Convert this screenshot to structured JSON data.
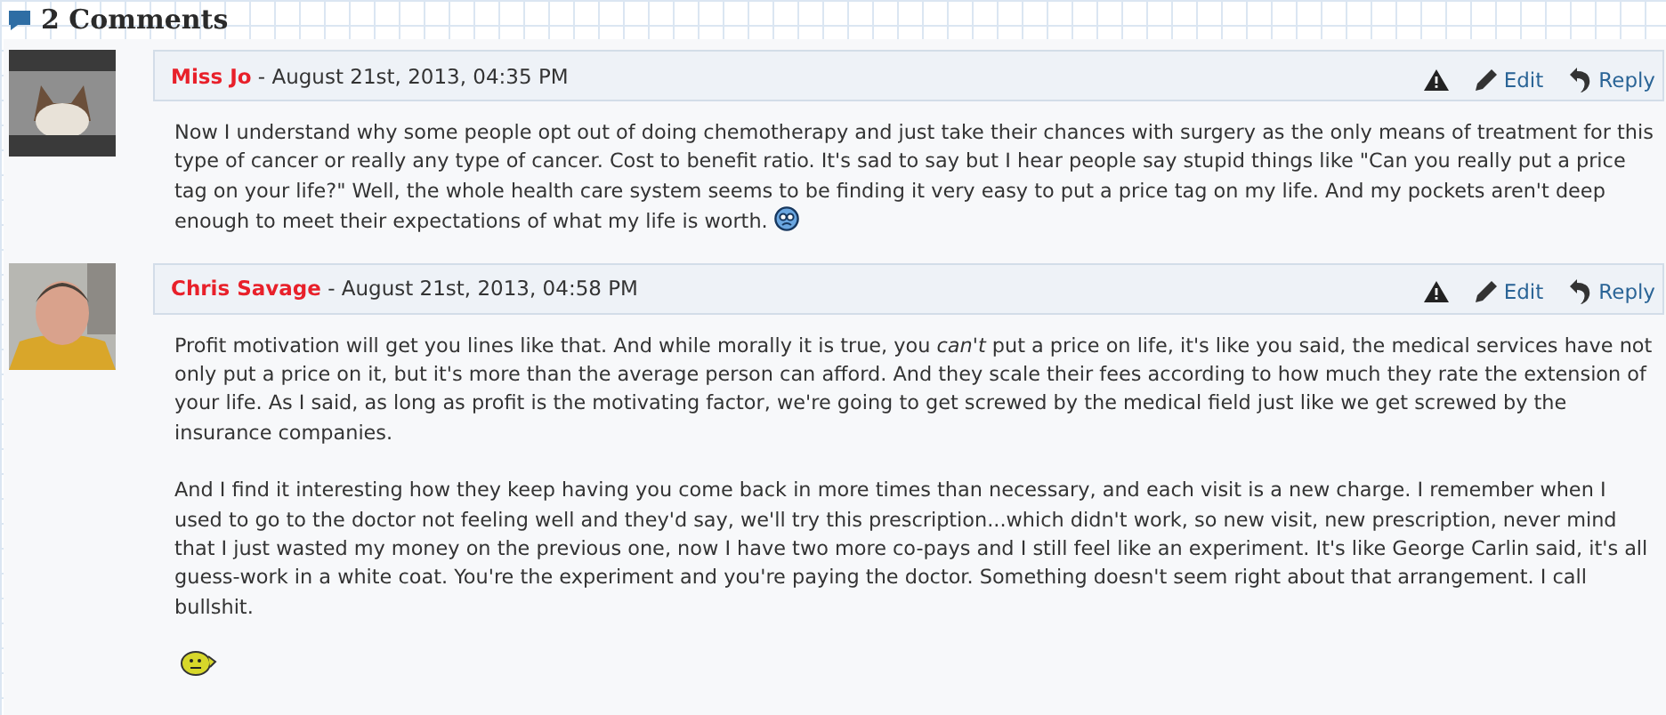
{
  "heading": {
    "count_label": "2 Comments"
  },
  "comments": [
    {
      "author": "Miss Jo",
      "date": " - August 21st, 2013, 04:35 PM",
      "avatar": {
        "kind": "picture"
      },
      "actions": [
        "Edit",
        "Reply"
      ],
      "trailing_emoticon": true,
      "paragraphs": [
        {
          "kind": "text",
          "text": "Now I understand why some people opt out of doing chemotherapy and just take their chances with surgery as the only means of treatment for this type of cancer or really any type of cancer. Cost to benefit ratio. It's sad to say but I hear people say stupid things like \"Can you really put a price tag on your life?\" Well, the whole health care system seems to be finding it very easy to put a price tag on my life. And my pockets aren't deep enough to meet their expectations of what my life is worth."
        }
      ]
    },
    {
      "author": "Chris Savage",
      "date": " - August 21st, 2013, 04:58 PM",
      "avatar": {
        "kind": "picture"
      },
      "actions": [
        "Edit",
        "Reply"
      ],
      "trailing_emoticon": false,
      "paragraphs": [
        {
          "kind": "text",
          "text": "Profit motivation will get you lines like that. And while morally it is true, you *can't* put a price on life, it's like you said, the medical services have not only put a price on it, but it's more than the average person can afford. And they scale their fees according to how much they rate the extension of your life. As I said, as long as profit is the motivating factor, we're going to get screwed by the medical field just like we get screwed by the insurance companies."
        },
        {
          "kind": "text",
          "text": "And I find it interesting how they keep having you come back in more times than necessary, and each visit is a new charge. I remember when I used to go to the doctor not feeling well and they'd say, we'll try this prescription...which didn't work, so new visit, new prescription, never mind that I just wasted my money on the previous one, now I have two more co-pays and I still feel like an experiment. It's like George Carlin said, it's all guess-work in a white coat. You're the experiment and you're paying the doctor. Something doesn't seem right about that arrangement. I call bullshit."
        },
        {
          "kind": "smiley"
        }
      ]
    }
  ]
}
